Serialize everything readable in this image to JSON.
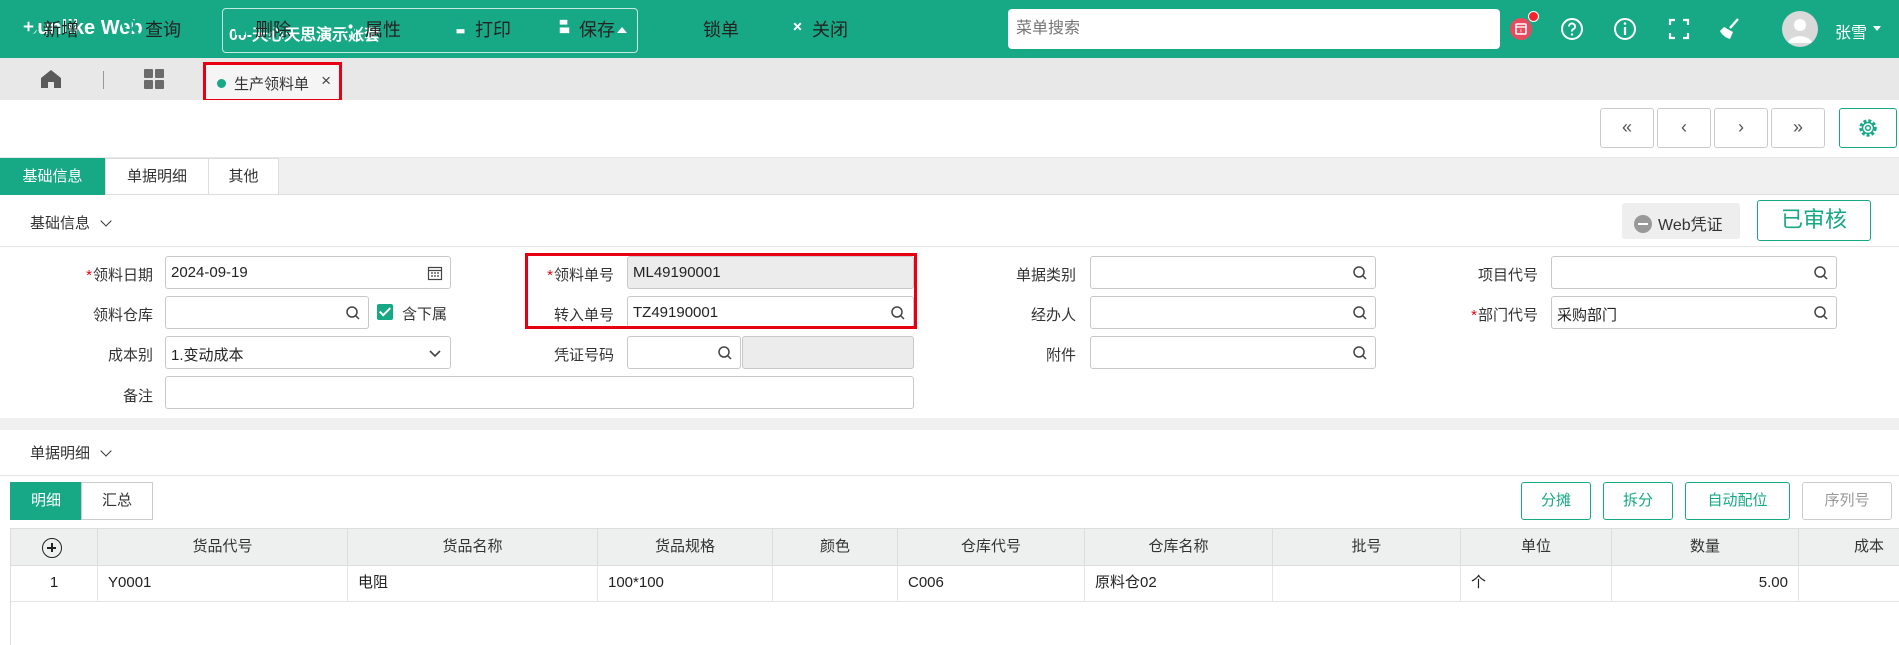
{
  "app": {
    "brand": "Sunlike Web",
    "account": "00-天心天思演示账套"
  },
  "header": {
    "search_placeholder": "菜单搜索",
    "username": "张雪"
  },
  "tabs": {
    "page_tab": "生产领料单"
  },
  "toolbar": {
    "add": "新增",
    "query": "查询",
    "delete": "删除",
    "properties": "属性",
    "print": "打印",
    "save": "保存",
    "lock": "锁单",
    "close": "关闭"
  },
  "section_tabs": [
    "基础信息",
    "单据明细",
    "其他"
  ],
  "basic": {
    "title": "基础信息",
    "web_voucher": "Web凭证",
    "status": "已审核"
  },
  "form": {
    "issue_date_label": "领料日期",
    "issue_date": "2024-09-19",
    "issue_no_label": "领料单号",
    "issue_no": "ML49190001",
    "doc_type_label": "单据类别",
    "doc_type": "",
    "project_label": "项目代号",
    "project": "",
    "warehouse_label": "领料仓库",
    "warehouse": "",
    "include_sub_label": "含下属",
    "transfer_no_label": "转入单号",
    "transfer_no": "TZ49190001",
    "handler_label": "经办人",
    "handler": "",
    "dept_label": "部门代号",
    "dept": "采购部门",
    "cost_label": "成本别",
    "cost": "1.变动成本",
    "voucher_label": "凭证号码",
    "voucher": "",
    "attachment_label": "附件",
    "attachment": "",
    "remark_label": "备注",
    "remark": ""
  },
  "detail": {
    "title": "单据明细",
    "subtabs": [
      "明细",
      "汇总"
    ],
    "buttons": {
      "allocate": "分摊",
      "split": "拆分",
      "auto": "自动配位",
      "serial": "序列号"
    },
    "columns": [
      "货品代号",
      "货品名称",
      "货品规格",
      "颜色",
      "仓库代号",
      "仓库名称",
      "批号",
      "单位",
      "数量",
      "成本"
    ],
    "rows": [
      {
        "idx": "1",
        "code": "Y0001",
        "name": "电阻",
        "spec": "100*100",
        "color": "",
        "wh_code": "C006",
        "wh_name": "原料仓02",
        "batch": "",
        "unit": "个",
        "qty": "5.00"
      }
    ]
  },
  "colors": {
    "accent": "#17a886",
    "highlight": "#e60012"
  }
}
